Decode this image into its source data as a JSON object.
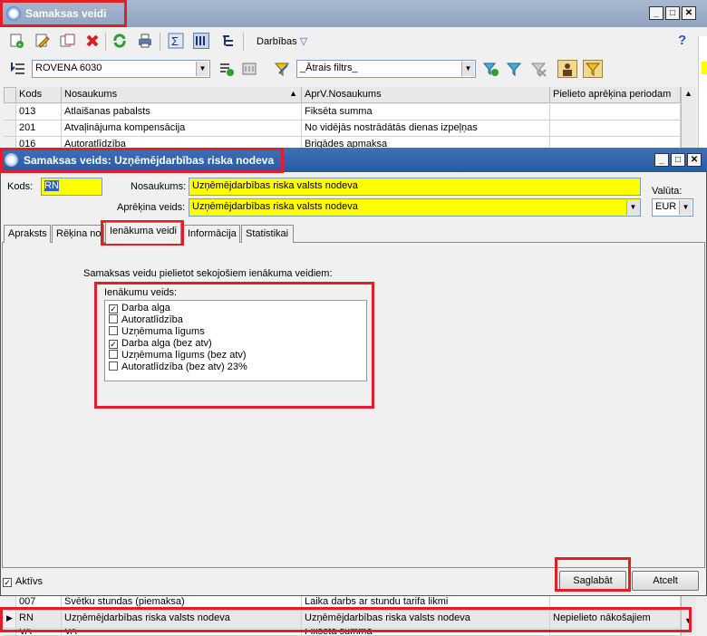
{
  "main_window": {
    "title": "Samaksas veidi",
    "menu_label": "Darbības",
    "company_combo": "ROVENA 6030",
    "filter_combo": "_Ātrais filtrs_"
  },
  "grid": {
    "headers": [
      "Kods",
      "Nosaukums",
      "AprV.Nosaukums",
      "Pielieto aprēķina periodam"
    ],
    "rows_top": [
      {
        "kods": "013",
        "nosaukums": "Atlaišanas pabalsts",
        "aprv": "Fiksēta summa",
        "pielieto": ""
      },
      {
        "kods": "201",
        "nosaukums": "Atvaļinājuma kompensācija",
        "aprv": "No vidējās nostrādātās dienas izpeļņas",
        "pielieto": ""
      },
      {
        "kods": "016",
        "nosaukums": "Autoratlīdzība",
        "aprv": "Brigādes apmaksa",
        "pielieto": ""
      }
    ],
    "rows_bottom": [
      {
        "kods": "007",
        "nosaukums": "Svētku stundas (piemaksa)",
        "aprv": "Laika darbs ar stundu tarifa likmi",
        "pielieto": ""
      },
      {
        "kods": "RN",
        "nosaukums": "Uzņēmējdarbības riska valsts nodeva",
        "aprv": "Uzņēmējdarbības riska valsts nodeva",
        "pielieto": "Nepielieto nākošajiem"
      },
      {
        "kods": "VA",
        "nosaukums": "VA",
        "aprv": "Fiksēta summa",
        "pielieto": ""
      }
    ]
  },
  "dialog": {
    "title": "Samaksas veids: Uzņēmējdarbības riska nodeva",
    "kods_label": "Kods:",
    "kods_value": "RN",
    "nosaukums_label": "Nosaukums:",
    "nosaukums_value": "Uzņēmējdarbības riska valsts nodeva",
    "aprekina_label": "Aprēķina veids:",
    "aprekina_value": "Uzņēmējdarbības riska valsts nodeva",
    "valuta_label": "Valūta:",
    "valuta_value": "EUR",
    "tabs": [
      "Apraksts",
      "Rēķina no",
      "Ienākuma veidi",
      "Informācija",
      "Statistikai"
    ],
    "instruction": "Samaksas veidu pielietot sekojošiem ienākuma veidiem:",
    "group_label": "Ienākumu veids:",
    "income_types": [
      {
        "label": "Darba alga",
        "checked": true
      },
      {
        "label": "Autoratlīdzība",
        "checked": false
      },
      {
        "label": "Uzņēmuma līgums",
        "checked": false
      },
      {
        "label": "Darba alga (bez atv)",
        "checked": true
      },
      {
        "label": "Uzņēmuma līgums (bez atv)",
        "checked": false
      },
      {
        "label": "Autoratlīdzība (bez atv) 23%",
        "checked": false
      }
    ],
    "aktivs_label": "Aktīvs",
    "save_label": "Saglabāt",
    "cancel_label": "Atcelt",
    "check_mark": "✓"
  },
  "colors": {
    "highlight": "#ffff00",
    "annotation": "#e21e26"
  }
}
